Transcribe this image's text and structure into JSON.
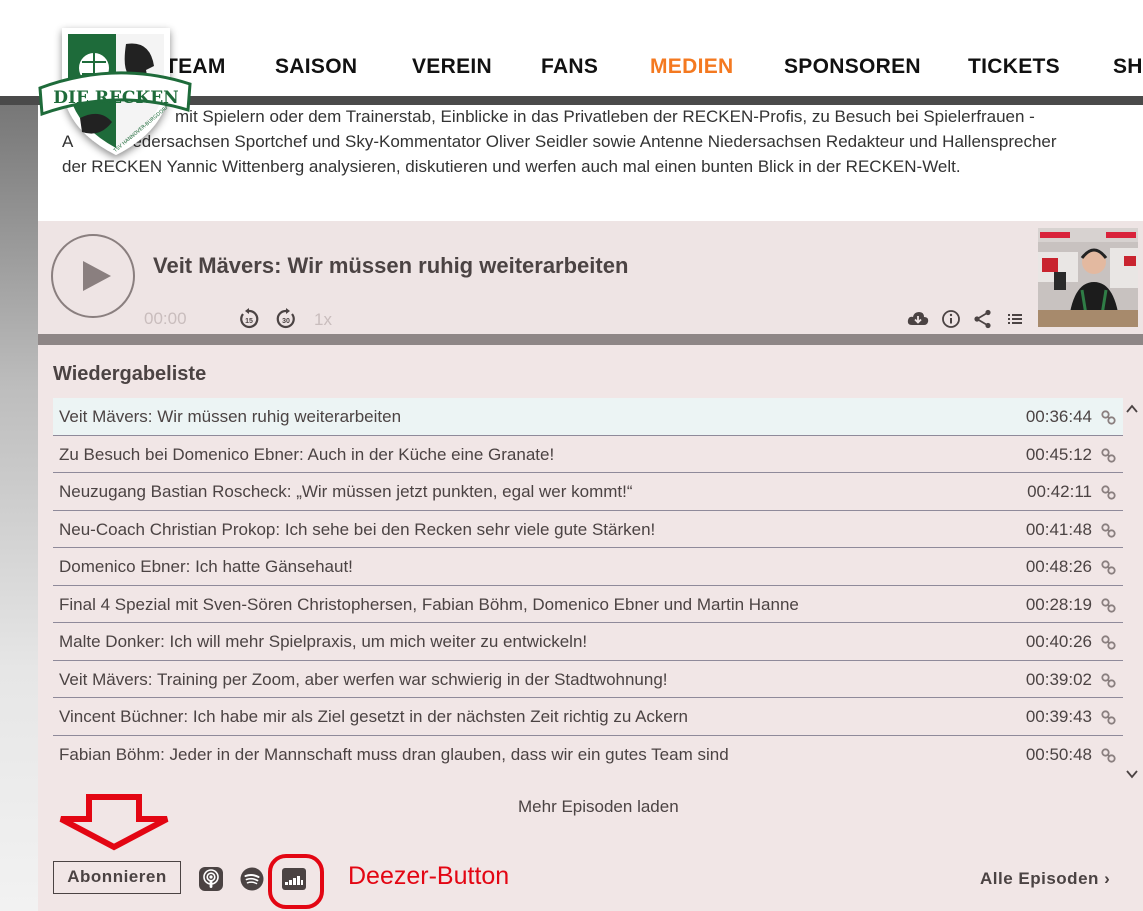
{
  "nav": {
    "items": [
      {
        "label": "TEAM",
        "active": false
      },
      {
        "label": "SAISON",
        "active": false
      },
      {
        "label": "VEREIN",
        "active": false
      },
      {
        "label": "FANS",
        "active": false
      },
      {
        "label": "MEDIEN",
        "active": true
      },
      {
        "label": "SPONSOREN",
        "active": false
      },
      {
        "label": "TICKETS",
        "active": false
      },
      {
        "label": "SH",
        "active": false
      }
    ],
    "active_color": "#f47920"
  },
  "logo": {
    "text": "DIE RECKEN",
    "subtext": "TSV HANNOVER-BURGDORF"
  },
  "description": {
    "line1": "mit Spielern oder dem Trainerstab, Einblicke in das Privatleben der RECKEN-Profis, zu Besuch bei Spielerfrauen -",
    "line2_prefix": "A",
    "line2": "edersachsen Sportchef und Sky-Kommentator Oliver Seidler sowie Antenne Niedersachsen Redakteur und Hallensprecher",
    "line3": "der RECKEN Yannic Wittenberg analysieren, diskutieren und werfen auch mal einen bunten Blick in der RECKEN-Welt."
  },
  "player": {
    "episode_title": "Veit Mävers: Wir müssen ruhig weiterarbeiten",
    "current_time": "00:00",
    "speed": "1x",
    "icons": [
      "play-icon",
      "rewind-15-icon",
      "forward-30-icon",
      "download-icon",
      "info-icon",
      "share-icon",
      "playlist-icon"
    ]
  },
  "playlist": {
    "heading": "Wiedergabeliste",
    "items": [
      {
        "title": "Veit Mävers: Wir müssen ruhig weiterarbeiten",
        "duration": "00:36:44",
        "active": true
      },
      {
        "title": "Zu Besuch bei Domenico Ebner: Auch in der Küche eine Granate!",
        "duration": "00:45:12",
        "active": false
      },
      {
        "title": "Neuzugang Bastian Roscheck: „Wir müssen jetzt punkten, egal wer kommt!“",
        "duration": "00:42:11",
        "active": false
      },
      {
        "title": "Neu-Coach Christian Prokop: Ich sehe bei den Recken sehr viele gute Stärken!",
        "duration": "00:41:48",
        "active": false
      },
      {
        "title": "Domenico Ebner: Ich hatte Gänsehaut!",
        "duration": "00:48:26",
        "active": false
      },
      {
        "title": "Final 4 Spezial mit Sven-Sören Christophersen, Fabian Böhm, Domenico Ebner und Martin Hanne",
        "duration": "00:28:19",
        "active": false
      },
      {
        "title": "Malte Donker: Ich will mehr Spielpraxis, um mich weiter zu entwickeln!",
        "duration": "00:40:26",
        "active": false
      },
      {
        "title": "Veit Mävers: Training per Zoom, aber werfen war schwierig in der Stadtwohnung!",
        "duration": "00:39:02",
        "active": false
      },
      {
        "title": "Vincent Büchner: Ich habe mir als Ziel gesetzt in der nächsten Zeit richtig zu Ackern",
        "duration": "00:39:43",
        "active": false
      },
      {
        "title": "Fabian Böhm: Jeder in der Mannschaft muss dran glauben, dass wir ein gutes Team sind",
        "duration": "00:50:48",
        "active": false
      }
    ],
    "more_label": "Mehr Episoden laden"
  },
  "footer": {
    "subscribe_label": "Abonnieren",
    "subscribe_icons": [
      "apple-podcasts-icon",
      "spotify-icon",
      "deezer-icon"
    ],
    "annotation": "Deezer-Button",
    "all_episodes_label": "Alle Episoden ›"
  },
  "colors": {
    "annotation_red": "#e30613",
    "player_bg": "#eee4e4",
    "playlist_bg": "#f1e6e6",
    "active_row_bg": "#ecf4f4",
    "text": "#4b4343"
  }
}
